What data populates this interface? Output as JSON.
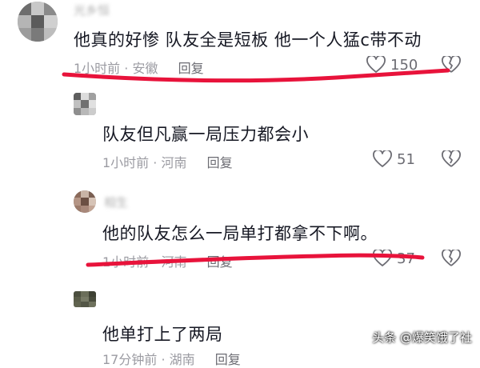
{
  "comments": [
    {
      "user": "光乡恒",
      "text": "他真的好惨 队友全是短板 他一个人猛c带不动",
      "time": "1小时前",
      "location": "安徽",
      "reply_label": "回复",
      "likes": "150"
    },
    {
      "user": "",
      "text": "队友但凡赢一局压力都会小",
      "time": "1小时前",
      "location": "河南",
      "reply_label": "回复",
      "likes": "51"
    },
    {
      "user": "相生",
      "text": "他的队友怎么一局单打都拿不下啊。",
      "time": "1小时前",
      "location": "河南",
      "reply_label": "回复",
      "likes": "37"
    },
    {
      "user": "",
      "text": "他单打上了两局",
      "time": "17分钟前",
      "location": "湖南",
      "reply_label": "回复",
      "likes": ""
    }
  ],
  "watermark": "头条 @爆笑饿了社",
  "colors": {
    "annotation_red": "#e8133b",
    "meta_gray": "#9b9ba2",
    "text": "#161823"
  },
  "icons": [
    "heart-outline-icon",
    "broken-heart-icon"
  ]
}
